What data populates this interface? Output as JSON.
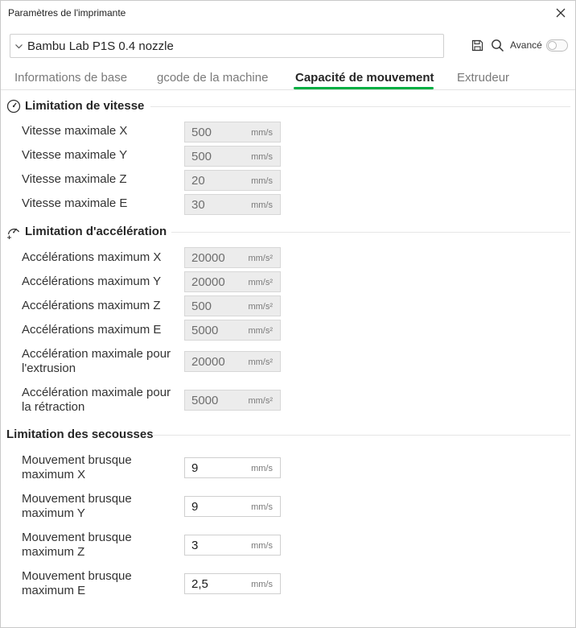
{
  "window": {
    "title": "Paramètres de l'imprimante"
  },
  "header": {
    "preset_name": "Bambu Lab P1S 0.4 nozzle",
    "advanced_label": "Avancé",
    "advanced_enabled": false
  },
  "tabs": [
    {
      "label": "Informations de base",
      "active": false
    },
    {
      "label": "gcode de la machine",
      "active": false
    },
    {
      "label": "Capacité de mouvement",
      "active": true
    },
    {
      "label": "Extrudeur",
      "active": false
    }
  ],
  "sections": {
    "speed": {
      "title": "Limitation de vitesse",
      "icon": "speedometer-icon",
      "rows": [
        {
          "label": "Vitesse maximale X",
          "value": "500",
          "unit": "mm/s"
        },
        {
          "label": "Vitesse maximale Y",
          "value": "500",
          "unit": "mm/s"
        },
        {
          "label": "Vitesse maximale Z",
          "value": "20",
          "unit": "mm/s"
        },
        {
          "label": "Vitesse maximale E",
          "value": "30",
          "unit": "mm/s"
        }
      ]
    },
    "accel": {
      "title": "Limitation d'accélération",
      "icon": "acceleration-icon",
      "rows": [
        {
          "label": "Accélérations maximum X",
          "value": "20000",
          "unit": "mm/s²"
        },
        {
          "label": "Accélérations maximum Y",
          "value": "20000",
          "unit": "mm/s²"
        },
        {
          "label": "Accélérations maximum Z",
          "value": "500",
          "unit": "mm/s²"
        },
        {
          "label": "Accélérations maximum E",
          "value": "5000",
          "unit": "mm/s²"
        },
        {
          "label": "Accélération maximale pour l'extrusion",
          "value": "20000",
          "unit": "mm/s²"
        },
        {
          "label": "Accélération maximale pour la rétraction",
          "value": "5000",
          "unit": "mm/s²"
        }
      ]
    },
    "jerk": {
      "title": "Limitation des secousses",
      "rows": [
        {
          "label": "Mouvement brusque maximum X",
          "value": "9",
          "unit": "mm/s"
        },
        {
          "label": "Mouvement brusque maximum Y",
          "value": "9",
          "unit": "mm/s"
        },
        {
          "label": "Mouvement brusque maximum Z",
          "value": "3",
          "unit": "mm/s"
        },
        {
          "label": "Mouvement brusque maximum E",
          "value": "2,5",
          "unit": "mm/s"
        }
      ]
    }
  },
  "colors": {
    "accent": "#00ae42",
    "disabled_field": "#ececec",
    "text": "#262626"
  }
}
